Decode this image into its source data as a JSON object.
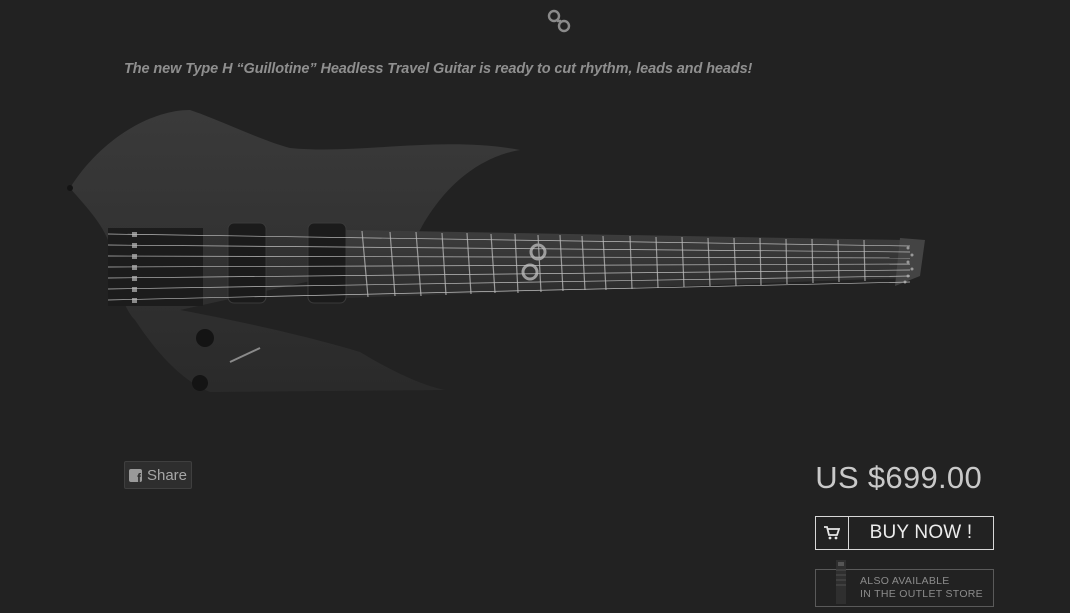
{
  "brand": {
    "logo_icon": "strandberg-logo-icon"
  },
  "product": {
    "tagline": "The new Type H “Guillotine” Headless Travel Guitar is ready to cut rhythm, leads and heads!",
    "image_alt": "Type H Guillotine headless 7-string guitar",
    "price": "US $699.00"
  },
  "share": {
    "label": "Share",
    "icon": "facebook-icon"
  },
  "cart": {
    "buy_label": "BUY NOW !",
    "icon": "cart-icon"
  },
  "outlet": {
    "line1": "ALSO AVAILABLE",
    "line2": "IN THE OUTLET STORE"
  },
  "colors": {
    "background": "#222222",
    "text": "#c9c9c9",
    "accent_border": "#d8d8d8"
  }
}
